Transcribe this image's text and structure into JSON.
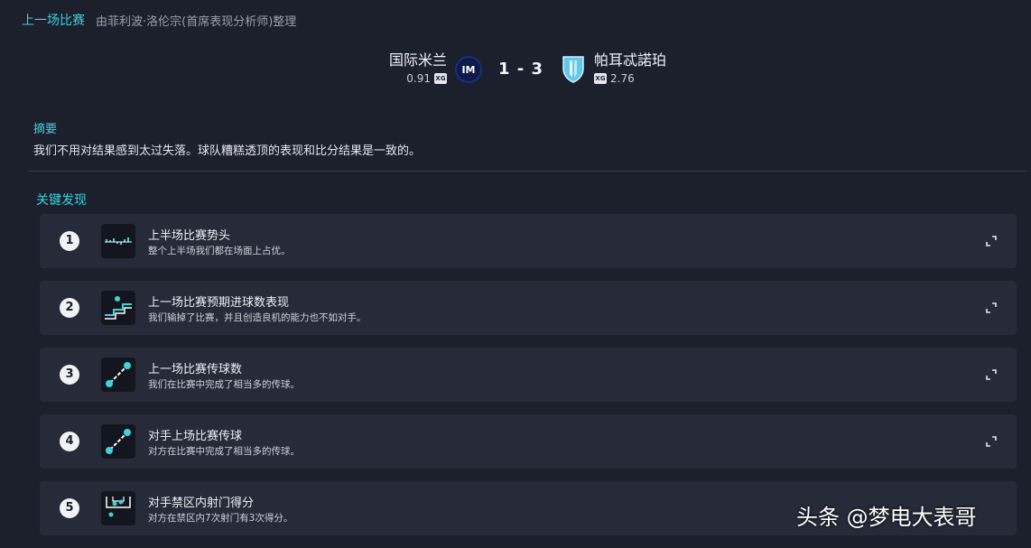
{
  "header": {
    "title": "上一场比赛",
    "subtitle": "由菲利波·洛伦宗(首席表现分析师)整理"
  },
  "match": {
    "home": {
      "name": "国际米兰",
      "xg": "0.91",
      "xg_badge": "XG"
    },
    "away": {
      "name": "帕耳忒諾珀",
      "xg": "2.76",
      "xg_badge": "XG"
    },
    "score": "1 - 3",
    "colors": {
      "accent": "#3dd2dc",
      "home_crest": "#0d1a4a",
      "away_crest": "#5ec8ee"
    }
  },
  "summary": {
    "label": "摘要",
    "text": "我们不用对结果感到太过失落。球队糟糕透顶的表现和比分结果是一致的。"
  },
  "findings": {
    "label": "关键发现",
    "items": [
      {
        "num": "1",
        "title": "上半场比赛势头",
        "desc": "整个上半场我们都在场面上占优。",
        "icon": "momentum-icon"
      },
      {
        "num": "2",
        "title": "上一场比赛预期进球数表现",
        "desc": "我们输掉了比赛，并且创造良机的能力也不如对手。",
        "icon": "xg-chart-icon"
      },
      {
        "num": "3",
        "title": "上一场比赛传球数",
        "desc": "我们在比赛中完成了相当多的传球。",
        "icon": "passes-icon"
      },
      {
        "num": "4",
        "title": "对手上场比赛传球",
        "desc": "对方在比赛中完成了相当多的传球。",
        "icon": "passes-icon"
      },
      {
        "num": "5",
        "title": "对手禁区内射门得分",
        "desc": "对方在禁区内7次射门有3次得分。",
        "icon": "penalty-box-icon"
      }
    ]
  },
  "watermark": "头条 @梦电大表哥"
}
